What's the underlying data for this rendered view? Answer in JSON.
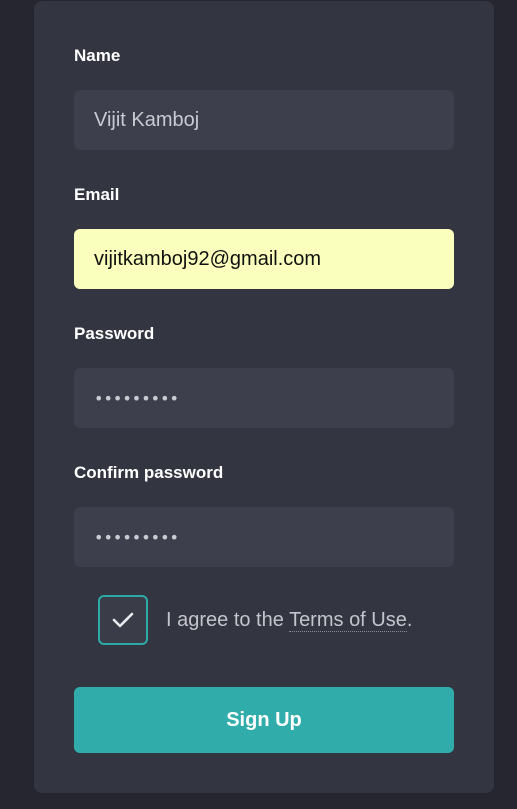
{
  "form": {
    "name": {
      "label": "Name",
      "value": "Vijit Kamboj"
    },
    "email": {
      "label": "Email",
      "value": "vijitkamboj92@gmail.com"
    },
    "password": {
      "label": "Password",
      "value": "•••••••••"
    },
    "confirm_password": {
      "label": "Confirm password",
      "value": "•••••••••"
    },
    "agree": {
      "text_before": "I agree to the ",
      "link_text": "Terms of Use",
      "text_after": ".",
      "checked": true
    },
    "submit_label": "Sign Up"
  },
  "colors": {
    "page_bg": "#25262f",
    "card_bg": "#333540",
    "input_bg": "#3d3f4c",
    "autofill_bg": "#faffbd",
    "accent": "#30adab",
    "checkbox_border": "#2fa9a8"
  },
  "icons": {
    "checkbox_mark": "check-icon"
  }
}
